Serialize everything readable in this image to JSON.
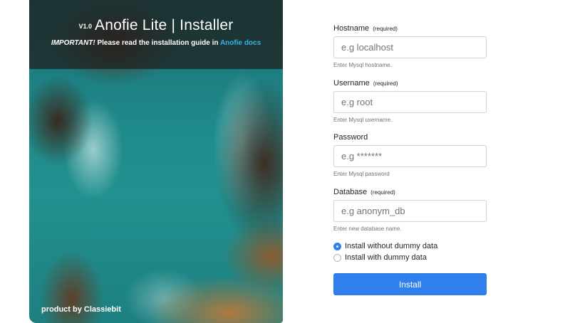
{
  "hero": {
    "version": "V1.0",
    "app_name": "Anofie Lite | Installer",
    "notice_important": "IMPORTANT!",
    "notice_text": "Please read the installation guide in",
    "notice_link": "Anofie docs",
    "credit": "product by Classiebit"
  },
  "form": {
    "required_marker": "(required)",
    "fields": [
      {
        "label": "Hostname",
        "placeholder": "e.g localhost",
        "help": "Enter Mysql hostname.",
        "value": ""
      },
      {
        "label": "Username",
        "placeholder": "e.g root",
        "help": "Enter Mysql username.",
        "value": ""
      },
      {
        "label": "Password",
        "placeholder": "e.g *******",
        "help": "Enter Mysql password",
        "value": ""
      },
      {
        "label": "Database",
        "placeholder": "e.g anonym_db",
        "help": "Enter new database name.",
        "value": ""
      }
    ],
    "options": [
      {
        "label": "Install without dummy data",
        "checked": true
      },
      {
        "label": "Install with dummy data",
        "checked": false
      }
    ],
    "submit_label": "Install"
  },
  "colors": {
    "primary": "#2f80ed",
    "link": "#35b3e6"
  }
}
